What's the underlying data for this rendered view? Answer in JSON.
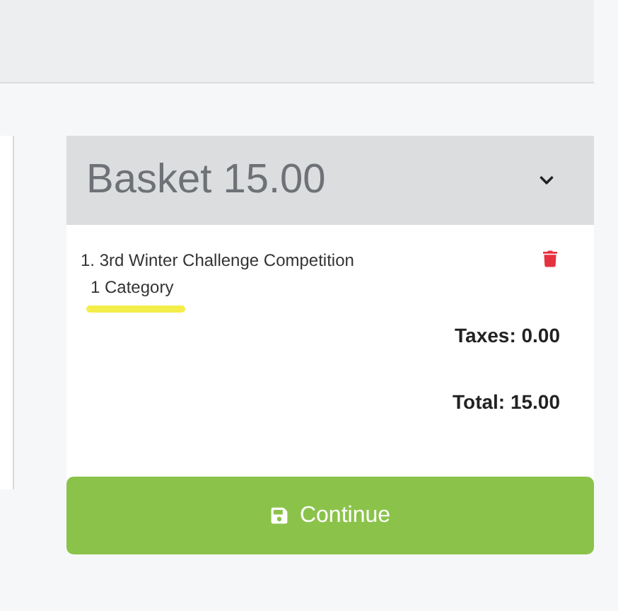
{
  "basket": {
    "title": "Basket 15.00",
    "expanded": true,
    "items": [
      {
        "label": "1. 3rd Winter Challenge Competition",
        "detail": "1 Category"
      }
    ],
    "taxes": "Taxes: 0.00",
    "total": "Total: 15.00",
    "continue_button": "Continue"
  }
}
